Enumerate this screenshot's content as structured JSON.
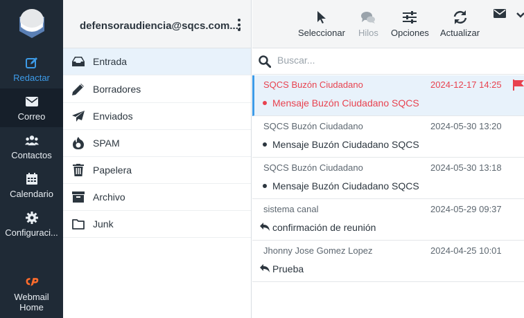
{
  "nav": {
    "items": [
      {
        "label": "Redactar",
        "icon": "compose-icon"
      },
      {
        "label": "Correo",
        "icon": "envelope-icon"
      },
      {
        "label": "Contactos",
        "icon": "users-icon"
      },
      {
        "label": "Calendario",
        "icon": "calendar-icon"
      },
      {
        "label": "Configuraci...",
        "icon": "gear-icon"
      },
      {
        "label_line1": "Webmail",
        "label_line2": "Home",
        "icon": "cpanel-icon"
      }
    ]
  },
  "account": {
    "email": "defensoraudiencia@sqcs.com...."
  },
  "folders": [
    {
      "label": "Entrada",
      "icon": "inbox-icon"
    },
    {
      "label": "Borradores",
      "icon": "pencil-icon"
    },
    {
      "label": "Enviados",
      "icon": "paper-plane-icon"
    },
    {
      "label": "SPAM",
      "icon": "fire-icon"
    },
    {
      "label": "Papelera",
      "icon": "trash-icon"
    },
    {
      "label": "Archivo",
      "icon": "archive-icon"
    },
    {
      "label": "Junk",
      "icon": "folder-icon"
    }
  ],
  "toolbar": {
    "select": "Seleccionar",
    "threads": "Hilos",
    "options": "Opciones",
    "refresh": "Actualizar"
  },
  "search": {
    "placeholder": "Buscar..."
  },
  "messages": [
    {
      "from": "SQCS Buzón Ciudadano",
      "date": "2024-12-17 14:25",
      "subject": "Mensaje Buzón Ciudadano SQCS"
    },
    {
      "from": "SQCS Buzón Ciudadano",
      "date": "2024-05-30 13:20",
      "subject": "Mensaje Buzón Ciudadano SQCS"
    },
    {
      "from": "SQCS Buzón Ciudadano",
      "date": "2024-05-30 13:18",
      "subject": "Mensaje Buzón Ciudadano SQCS"
    },
    {
      "from": "sistema canal",
      "date": "2024-05-29 09:37",
      "subject": "confirmación de reunión"
    },
    {
      "from": "Jhonny Jose Gomez Lopez",
      "date": "2024-04-25 10:01",
      "subject": "Prueba"
    }
  ],
  "colors": {
    "accent": "#3d9be8",
    "flagged": "#e8424f",
    "nav_bg": "#1f2a36",
    "cpanel": "#ff6c2c"
  }
}
